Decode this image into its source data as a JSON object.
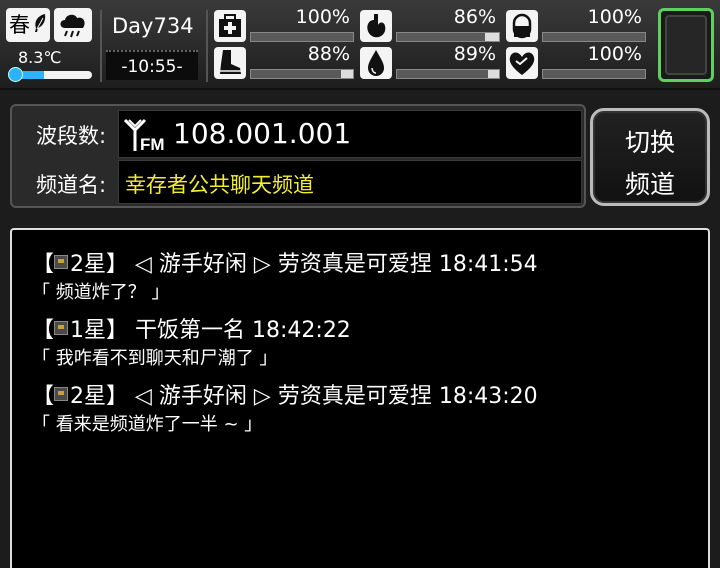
{
  "status": {
    "season": "春",
    "temperature": "8.3℃",
    "temperature_level": 0.35,
    "day": "Day734",
    "time": "-10:55-",
    "stats": [
      {
        "name": "health",
        "icon": "medkit-icon",
        "value": "100%",
        "level": 1.0
      },
      {
        "name": "hunger",
        "icon": "stomach-icon",
        "value": "86%",
        "level": 0.86
      },
      {
        "name": "medicine",
        "icon": "pill-icon",
        "value": "100%",
        "level": 1.0
      },
      {
        "name": "stamina",
        "icon": "boot-icon",
        "value": "88%",
        "level": 0.88
      },
      {
        "name": "thirst",
        "icon": "water-drop-icon",
        "value": "89%",
        "level": 0.89
      },
      {
        "name": "mood",
        "icon": "heart-icon",
        "value": "100%",
        "level": 1.0
      }
    ]
  },
  "radio": {
    "band_label": "波段数:",
    "frequency": "108.001.001",
    "channel_label": "频道名:",
    "channel_name": "幸存者公共聊天频道",
    "switch_line1": "切换",
    "switch_line2": "频道"
  },
  "colors": {
    "channel_text": "#f2ee2e",
    "slot_border": "#5dd05d",
    "temperature_blue": "#2ab4ff"
  },
  "messages": [
    {
      "header": "【 2星】 ◁ 游手好闲 ▷ 劳资真是可爱捏 18:41:54",
      "prefix": "【",
      "badge": "2星】",
      "text": " ◁ 游手好闲 ▷ 劳资真是可爱捏 18:41:54",
      "body": "「 频道炸了？ 」"
    },
    {
      "header": "【 1星】 干饭第一名 18:42:22",
      "prefix": "【",
      "badge": "1星】",
      "text": " 干饭第一名 18:42:22",
      "body": "「 我咋看不到聊天和尸潮了 」"
    },
    {
      "header": "【 2星】 ◁ 游手好闲 ▷ 劳资真是可爱捏 18:43:20",
      "prefix": "【",
      "badge": "2星】",
      "text": " ◁ 游手好闲 ▷ 劳资真是可爱捏 18:43:20",
      "body": "「 看来是频道炸了一半 ~ 」"
    }
  ]
}
